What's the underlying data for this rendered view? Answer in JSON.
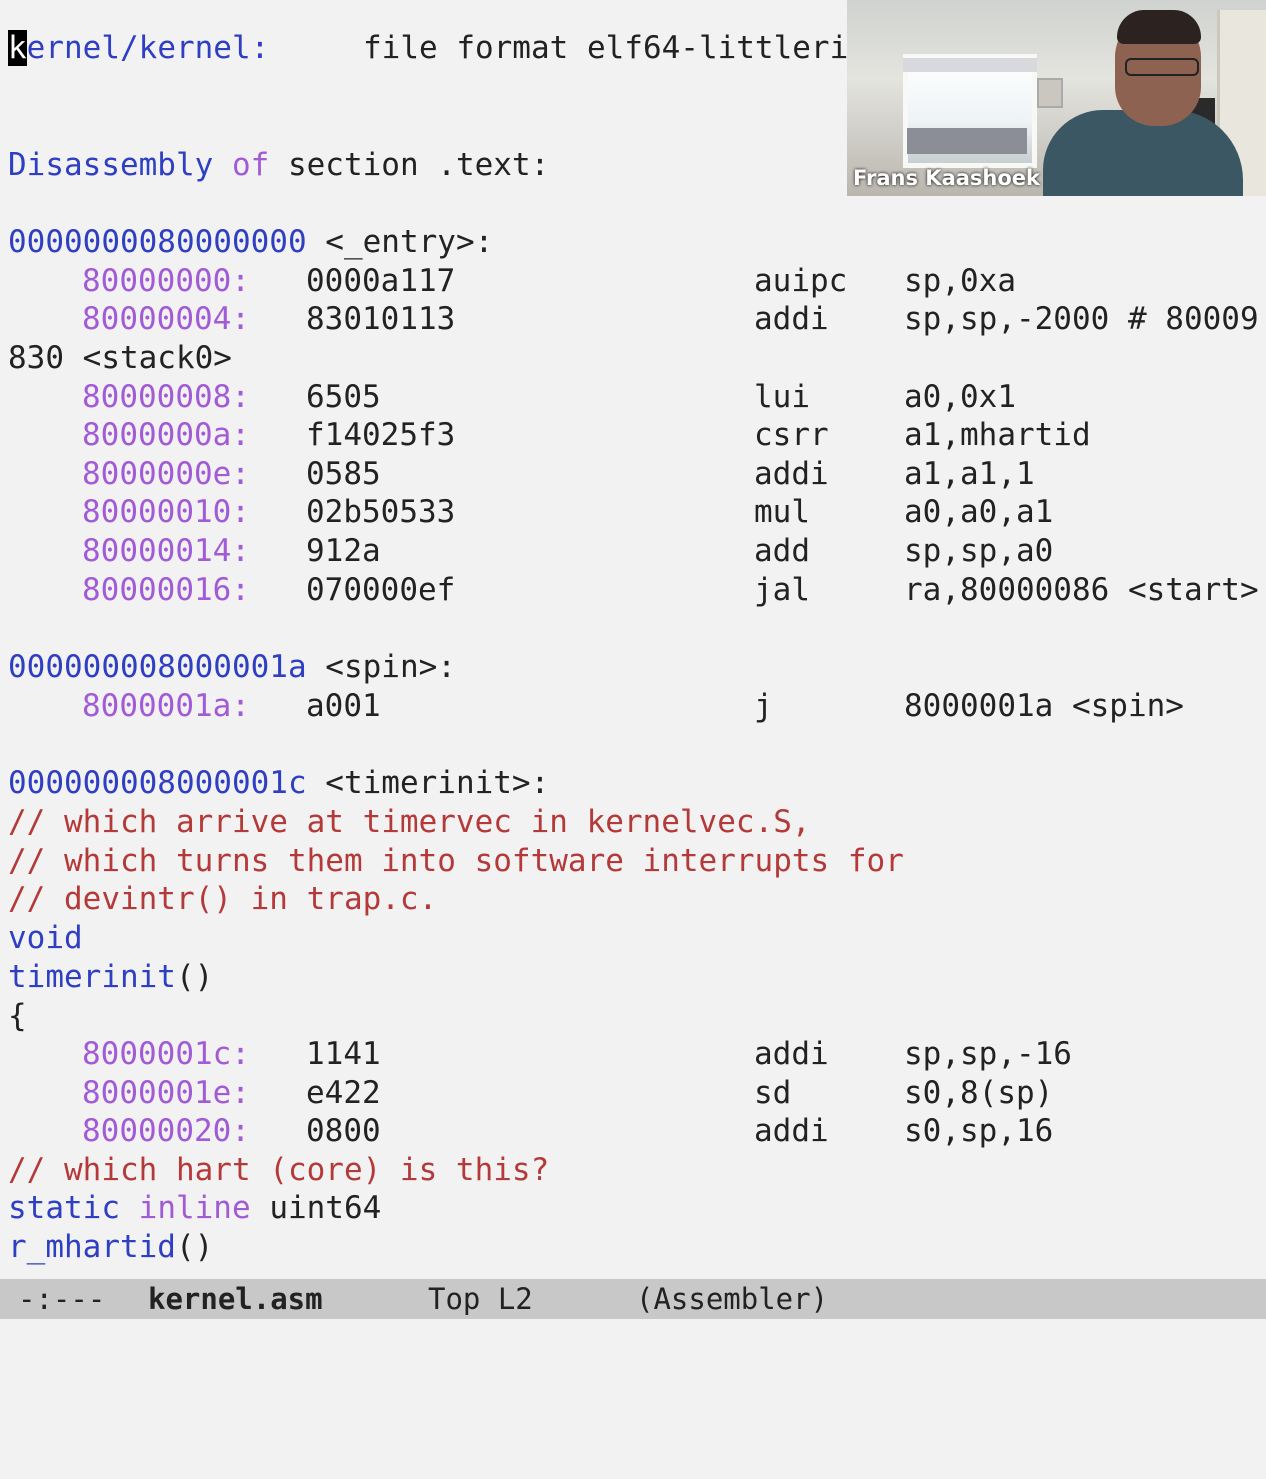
{
  "header": {
    "cursor_char": "k",
    "path_rest": "ernel/kernel:",
    "format_text": "file format elf64-littleri"
  },
  "disasm_header": {
    "kw1": "Disassembly",
    "kw2": "of",
    "rest": "section .text:"
  },
  "entry": {
    "address": "0000000080000000",
    "label": "<_entry>:",
    "rows": [
      {
        "addr": "80000000:",
        "hex": "0000a117",
        "op": "auipc",
        "args": "sp,0xa"
      },
      {
        "addr": "80000004:",
        "hex": "83010113",
        "op": "addi",
        "args": "sp,sp,-2000 # 80009"
      }
    ],
    "wrap_line": "830 <stack0>",
    "rows2": [
      {
        "addr": "80000008:",
        "hex": "6505",
        "op": "lui",
        "args": "a0,0x1"
      },
      {
        "addr": "8000000a:",
        "hex": "f14025f3",
        "op": "csrr",
        "args": "a1,mhartid"
      },
      {
        "addr": "8000000e:",
        "hex": "0585",
        "op": "addi",
        "args": "a1,a1,1"
      },
      {
        "addr": "80000010:",
        "hex": "02b50533",
        "op": "mul",
        "args": "a0,a0,a1"
      },
      {
        "addr": "80000014:",
        "hex": "912a",
        "op": "add",
        "args": "sp,sp,a0"
      },
      {
        "addr": "80000016:",
        "hex": "070000ef",
        "op": "jal",
        "args": "ra,80000086 <start>"
      }
    ]
  },
  "spin": {
    "address": "000000008000001a",
    "label": "<spin>:",
    "rows": [
      {
        "addr": "8000001a:",
        "hex": "a001",
        "op": "j",
        "args": "8000001a <spin>"
      }
    ]
  },
  "timerinit": {
    "address": "000000008000001c",
    "label": "<timerinit>:",
    "comments": [
      "// which arrive at timervec in kernelvec.S,",
      "// which turns them into software interrupts for",
      "// devintr() in trap.c."
    ],
    "ret_type": "void",
    "func_name": "timerinit",
    "parens": "()",
    "brace": "{",
    "rows": [
      {
        "addr": "8000001c:",
        "hex": "1141",
        "op": "addi",
        "args": "sp,sp,-16"
      },
      {
        "addr": "8000001e:",
        "hex": "e422",
        "op": "sd",
        "args": "s0,8(sp)"
      },
      {
        "addr": "80000020:",
        "hex": "0800",
        "op": "addi",
        "args": "s0,sp,16"
      }
    ],
    "comment2": "// which hart (core) is this?",
    "kw_static": "static",
    "kw_inline": "inline",
    "type": "uint64",
    "func2": "r_mhartid",
    "parens2": "()"
  },
  "modeline": {
    "status": "-:---",
    "buffer": "kernel.asm",
    "position": "Top L2",
    "mode": "(Assembler)"
  },
  "video": {
    "participant_name": "Frans Kaashoek"
  }
}
